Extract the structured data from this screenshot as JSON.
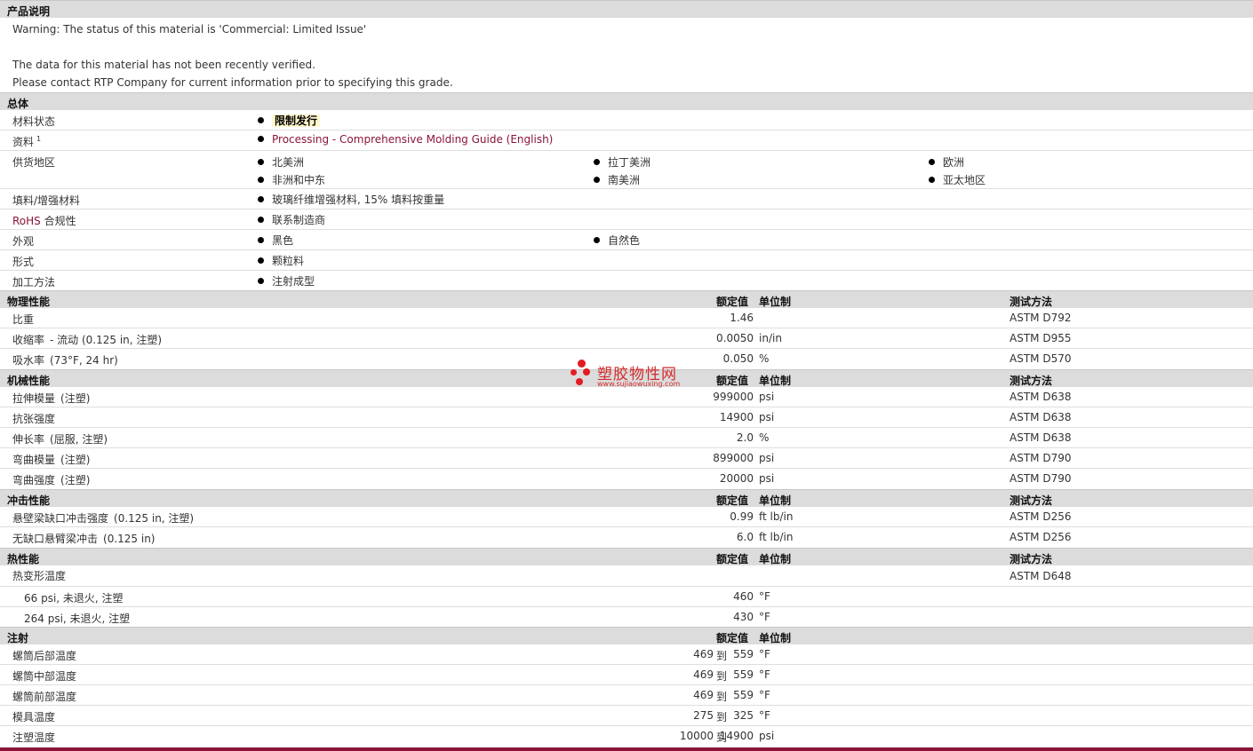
{
  "product_description": {
    "title": "产品说明",
    "warning": "Warning: The status of this material is 'Commercial: Limited Issue'",
    "note1": "The data for this material has not been recently verified.",
    "note2": "Please contact RTP Company for current information prior to specifying this grade."
  },
  "general": {
    "title": "总体",
    "material_status": {
      "label": "材料状态",
      "value": "限制发行"
    },
    "documents": {
      "label": "资料",
      "sup": "1",
      "value": "Processing - Comprehensive Molding Guide (English)"
    },
    "availability": {
      "label": "供货地区",
      "values": [
        "北美洲",
        "拉丁美洲",
        "欧洲",
        "非洲和中东",
        "南美洲",
        "亚太地区"
      ]
    },
    "filler": {
      "label": "填料/增强材料",
      "value": "玻璃纤维增强材料, 15% 填料按重量"
    },
    "rohs": {
      "label_prefix": "RoHS",
      "label_suffix": " 合规性",
      "value": "联系制造商"
    },
    "appearance": {
      "label": "外观",
      "values": [
        "黑色",
        "自然色"
      ]
    },
    "forms": {
      "label": "形式",
      "value": "颗粒料"
    },
    "processing": {
      "label": "加工方法",
      "value": "注射成型"
    }
  },
  "headers": {
    "nominal": "额定值",
    "unit": "单位制",
    "test": "测试方法"
  },
  "physical": {
    "title": "物理性能",
    "rows": [
      {
        "label": "比重",
        "cond": "",
        "value": "1.46",
        "unit": "",
        "test": "ASTM D792"
      },
      {
        "label": "收缩率",
        "cond": "- 流动  (0.125 in, 注塑)",
        "value": "0.0050",
        "unit": "in/in",
        "test": "ASTM D955"
      },
      {
        "label": "吸水率",
        "cond": "(73°F, 24 hr)",
        "value": "0.050",
        "unit": "%",
        "test": "ASTM D570"
      }
    ]
  },
  "mechanical": {
    "title": "机械性能",
    "rows": [
      {
        "label": "拉伸模量",
        "cond": "(注塑)",
        "value": "999000",
        "unit": "psi",
        "test": "ASTM D638"
      },
      {
        "label": "抗张强度",
        "cond": "",
        "value": "14900",
        "unit": "psi",
        "test": "ASTM D638"
      },
      {
        "label": "伸长率",
        "cond": "(屈服, 注塑)",
        "value": "2.0",
        "unit": "%",
        "test": "ASTM D638"
      },
      {
        "label": "弯曲模量",
        "cond": "(注塑)",
        "value": "899000",
        "unit": "psi",
        "test": "ASTM D790"
      },
      {
        "label": "弯曲强度",
        "cond": "(注塑)",
        "value": "20000",
        "unit": "psi",
        "test": "ASTM D790"
      }
    ]
  },
  "impact": {
    "title": "冲击性能",
    "rows": [
      {
        "label": "悬壁梁缺口冲击强度",
        "cond": "(0.125 in, 注塑)",
        "value": "0.99",
        "unit": "ft lb/in",
        "test": "ASTM D256"
      },
      {
        "label": "无缺口悬臂梁冲击",
        "cond": "(0.125 in)",
        "value": "6.0",
        "unit": "ft lb/in",
        "test": "ASTM D256"
      }
    ]
  },
  "thermal": {
    "title": "热性能",
    "hdt_label": "热变形温度",
    "hdt_test": "ASTM D648",
    "rows": [
      {
        "label": "66 psi, 未退火, 注塑",
        "value": "460",
        "unit": "°F"
      },
      {
        "label": "264 psi, 未退火, 注塑",
        "value": "430",
        "unit": "°F"
      }
    ]
  },
  "injection": {
    "title": "注射",
    "to": "到",
    "rows": [
      {
        "label": "螺筒后部温度",
        "min": "469",
        "max": "559",
        "unit": "°F"
      },
      {
        "label": "螺筒中部温度",
        "min": "469",
        "max": "559",
        "unit": "°F"
      },
      {
        "label": "螺筒前部温度",
        "min": "469",
        "max": "559",
        "unit": "°F"
      },
      {
        "label": "模具温度",
        "min": "275",
        "max": "325",
        "unit": "°F"
      },
      {
        "label": "注塑温度",
        "min": "10000",
        "max": "14900",
        "unit": "psi"
      }
    ]
  },
  "watermark": {
    "name": "塑胶物性网",
    "url": "www.sujiaowuxing.com"
  },
  "colors": {
    "link": "#8a1538",
    "section_bg": "#dcdcdc",
    "highlight": "#fff6cc"
  }
}
